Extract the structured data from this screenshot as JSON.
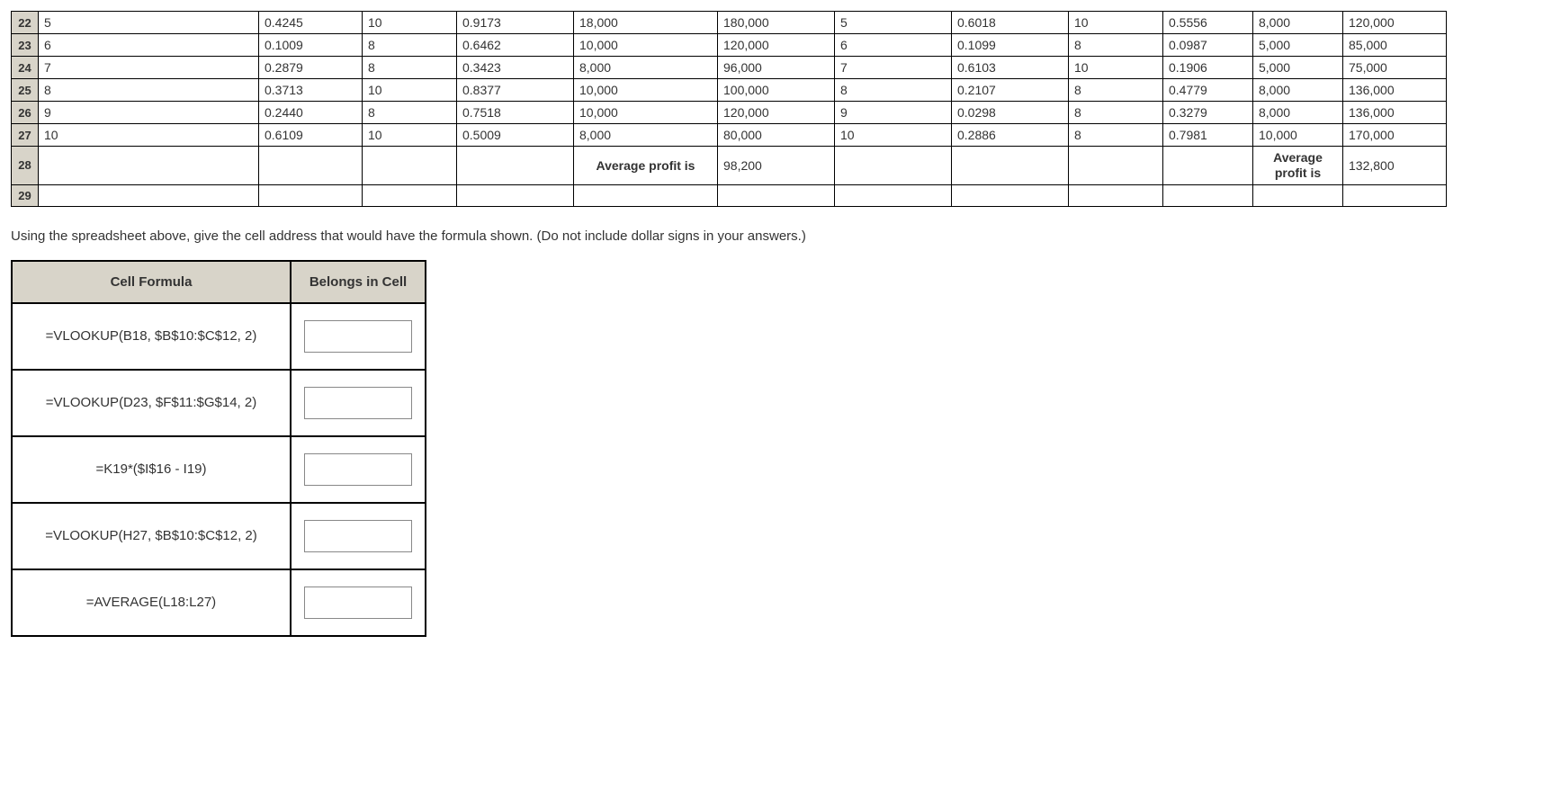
{
  "spreadsheet": {
    "rows": [
      {
        "n": "22",
        "c": [
          "5",
          "0.4245",
          "10",
          "0.9173",
          "18,000",
          "180,000",
          "5",
          "0.6018",
          "10",
          "0.5556",
          "8,000",
          "120,000"
        ]
      },
      {
        "n": "23",
        "c": [
          "6",
          "0.1009",
          "8",
          "0.6462",
          "10,000",
          "120,000",
          "6",
          "0.1099",
          "8",
          "0.0987",
          "5,000",
          "85,000"
        ]
      },
      {
        "n": "24",
        "c": [
          "7",
          "0.2879",
          "8",
          "0.3423",
          "8,000",
          "96,000",
          "7",
          "0.6103",
          "10",
          "0.1906",
          "5,000",
          "75,000"
        ]
      },
      {
        "n": "25",
        "c": [
          "8",
          "0.3713",
          "10",
          "0.8377",
          "10,000",
          "100,000",
          "8",
          "0.2107",
          "8",
          "0.4779",
          "8,000",
          "136,000"
        ]
      },
      {
        "n": "26",
        "c": [
          "9",
          "0.2440",
          "8",
          "0.7518",
          "10,000",
          "120,000",
          "9",
          "0.0298",
          "8",
          "0.3279",
          "8,000",
          "136,000"
        ]
      },
      {
        "n": "27",
        "c": [
          "10",
          "0.6109",
          "10",
          "0.5009",
          "8,000",
          "80,000",
          "10",
          "0.2886",
          "8",
          "0.7981",
          "10,000",
          "170,000"
        ]
      }
    ],
    "row28": {
      "n": "28",
      "lbl1a": "Average profit is",
      "val1": "98,200",
      "lbl2a": "Average",
      "lbl2b": "profit is",
      "val2": "132,800"
    },
    "row29": {
      "n": "29"
    }
  },
  "instruction": "Using the spreadsheet above, give the cell address that would have the formula shown. (Do not include dollar signs in your answers.)",
  "answerTable": {
    "hdr_formula": "Cell Formula",
    "hdr_belongs": "Belongs in Cell",
    "items": [
      {
        "f": "=VLOOKUP(B18, $B$10:$C$12, 2)"
      },
      {
        "f": "=VLOOKUP(D23, $F$11:$G$14, 2)"
      },
      {
        "f": "=K19*($I$16 - I19)"
      },
      {
        "f": "=VLOOKUP(H27, $B$10:$C$12, 2)"
      },
      {
        "f": "=AVERAGE(L18:L27)"
      }
    ]
  }
}
